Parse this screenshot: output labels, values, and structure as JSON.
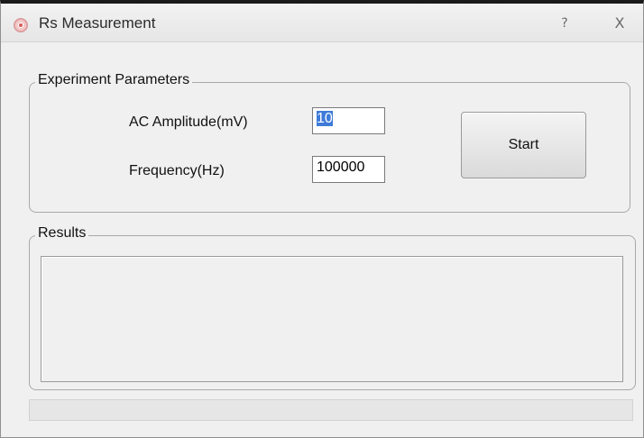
{
  "window": {
    "title": "Rs Measurement",
    "help_label": "?",
    "close_label": "X"
  },
  "parameters": {
    "group_title": "Experiment Parameters",
    "amplitude_label": "AC Amplitude(mV)",
    "amplitude_value": "10",
    "frequency_label": "Frequency(Hz)",
    "frequency_value": "100000",
    "start_label": "Start"
  },
  "results": {
    "group_title": "Results",
    "content": ""
  },
  "status": {
    "text": ""
  }
}
